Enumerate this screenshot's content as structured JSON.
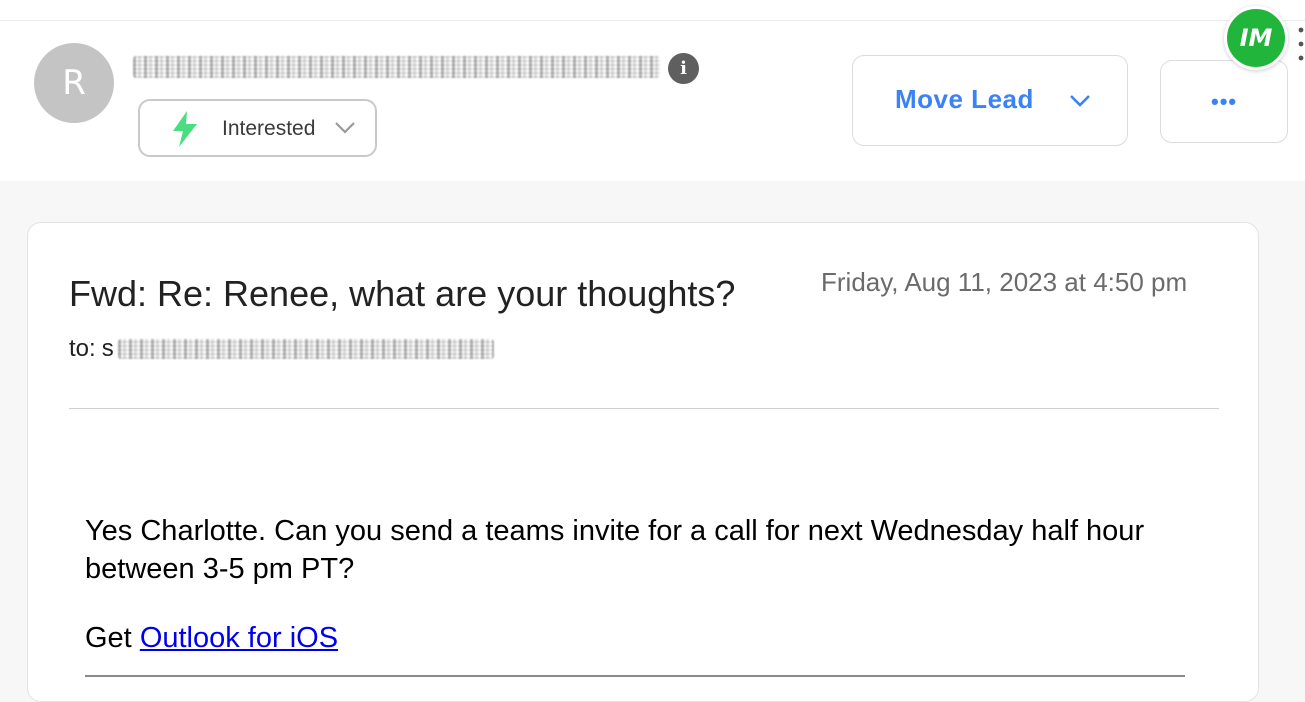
{
  "lead": {
    "avatar_initial": "R",
    "status_label": "Interested"
  },
  "header": {
    "move_lead_label": "Move Lead",
    "more_label": "•••",
    "extension_logo_text": "IM"
  },
  "email": {
    "subject": "Fwd: Re: Renee, what are your thoughts?",
    "date": "Friday, Aug 11, 2023 at 4:50 pm",
    "to_prefix": "to:",
    "to_visible_start": "s",
    "body": "Yes Charlotte.  Can you send a teams invite for a call for next Wednesday half hour between 3-5 pm PT?",
    "get_prefix": "Get ",
    "link_text": "Outlook for iOS"
  },
  "colors": {
    "accent_blue": "#3b82f6",
    "status_green": "#4ade80",
    "logo_green": "#22b53c",
    "link_blue": "#0000ee"
  },
  "icons": {
    "info": "info-icon",
    "bolt": "lightning-bolt-icon",
    "chevron": "chevron-down-icon",
    "more": "more-horizontal-icon",
    "kebab": "kebab-vertical-icon"
  }
}
